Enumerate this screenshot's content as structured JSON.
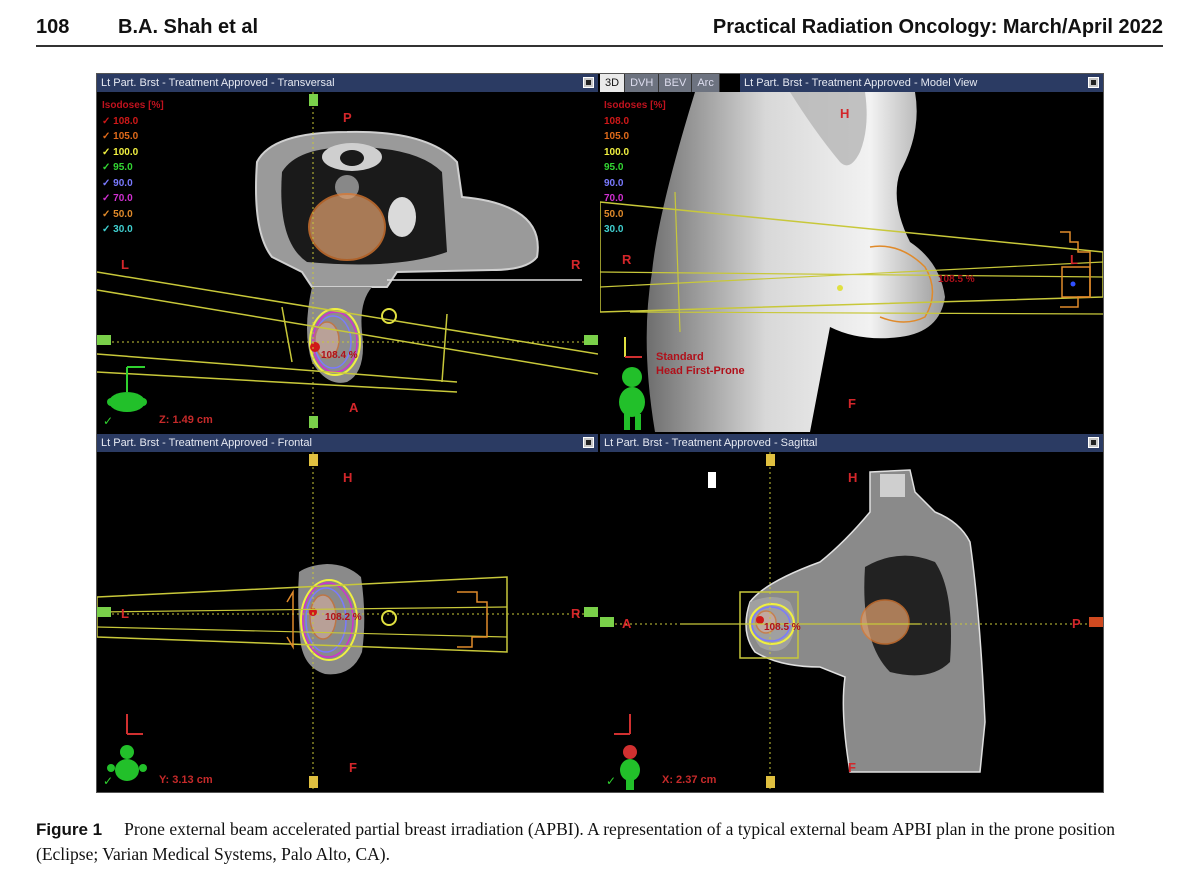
{
  "header": {
    "page_number": "108",
    "authors": "B.A. Shah et al",
    "journal": "Practical Radiation Oncology: March/April 2022"
  },
  "figure": {
    "panels": {
      "transversal": {
        "title": "Lt Part. Brst  -  Treatment Approved - Transversal",
        "coord": "Z: 1.49 cm",
        "dose_max": "108.4 %",
        "dirs": {
          "top": "P",
          "bottom": "A",
          "left": "L",
          "right": "R"
        }
      },
      "model": {
        "tabs": [
          "3D",
          "DVH",
          "BEV",
          "Arc"
        ],
        "title": "Lt Part. Brst  -  Treatment Approved - Model View",
        "dose_max": "108.5 %",
        "orientation_line1": "Standard",
        "orientation_line2": "Head First-Prone",
        "dirs": {
          "top": "H",
          "bottom": "F",
          "left": "R",
          "right": "L"
        }
      },
      "frontal": {
        "title": "Lt Part. Brst  -  Treatment Approved - Frontal",
        "coord": "Y: 3.13 cm",
        "dose_max": "108.2 %",
        "dirs": {
          "top": "H",
          "bottom": "F",
          "left": "L",
          "right": "R"
        }
      },
      "sagittal": {
        "title": "Lt Part. Brst  -  Treatment Approved - Sagittal",
        "coord": "X: 2.37 cm",
        "dose_max": "108.5 %",
        "dirs": {
          "top": "H",
          "bottom": "F",
          "left": "A",
          "right": "P"
        }
      }
    },
    "isodose_header": "Isodoses [%]",
    "isodoses": [
      {
        "label": "108.0",
        "color": "#d01818"
      },
      {
        "label": "105.0",
        "color": "#e06a1a"
      },
      {
        "label": "100.0",
        "color": "#f0f040"
      },
      {
        "label": "95.0",
        "color": "#33d633"
      },
      {
        "label": "90.0",
        "color": "#7a7aff"
      },
      {
        "label": "70.0",
        "color": "#d030d0"
      },
      {
        "label": "50.0",
        "color": "#e08a2a"
      },
      {
        "label": "30.0",
        "color": "#40d0d0"
      }
    ]
  },
  "caption": {
    "label": "Figure 1",
    "text": "Prone external beam accelerated partial breast irradiation (APBI). A representation of a typical external beam APBI plan in the prone position (Eclipse; Varian Medical Systems, Palo Alto, CA)."
  }
}
